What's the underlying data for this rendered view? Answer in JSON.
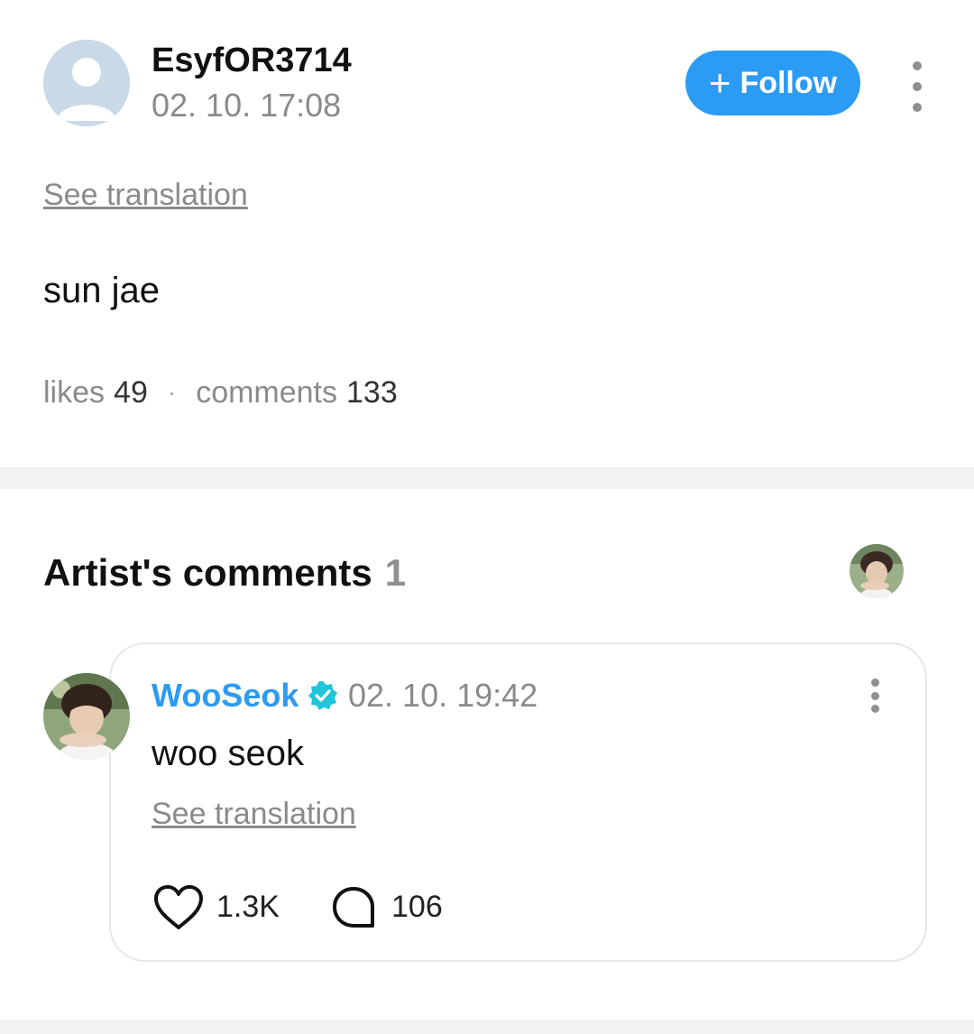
{
  "post": {
    "author": "EsyfOR3714",
    "timestamp": "02. 10. 17:08",
    "follow_label": "Follow",
    "see_translation": "See translation",
    "body": "sun jae",
    "likes_label": "likes",
    "likes_count": "49",
    "comments_label": "comments",
    "comments_count": "133",
    "separator": "·"
  },
  "artist_comments": {
    "title": "Artist's comments",
    "count": "1",
    "comment": {
      "author": "WooSeok",
      "timestamp": "02. 10. 19:42",
      "body": "woo seok",
      "see_translation": "See translation",
      "likes": "1.3K",
      "replies": "106"
    }
  },
  "icons": {
    "follow": "plus-icon",
    "more": "more-vertical-icon",
    "verified": "verified-badge-icon",
    "like": "heart-icon",
    "reply": "comment-bubble-icon"
  },
  "colors": {
    "accent": "#2b9bf4",
    "verified": "#21c5d8",
    "muted_text": "#8a8a8a",
    "divider": "#f2f2f4"
  }
}
